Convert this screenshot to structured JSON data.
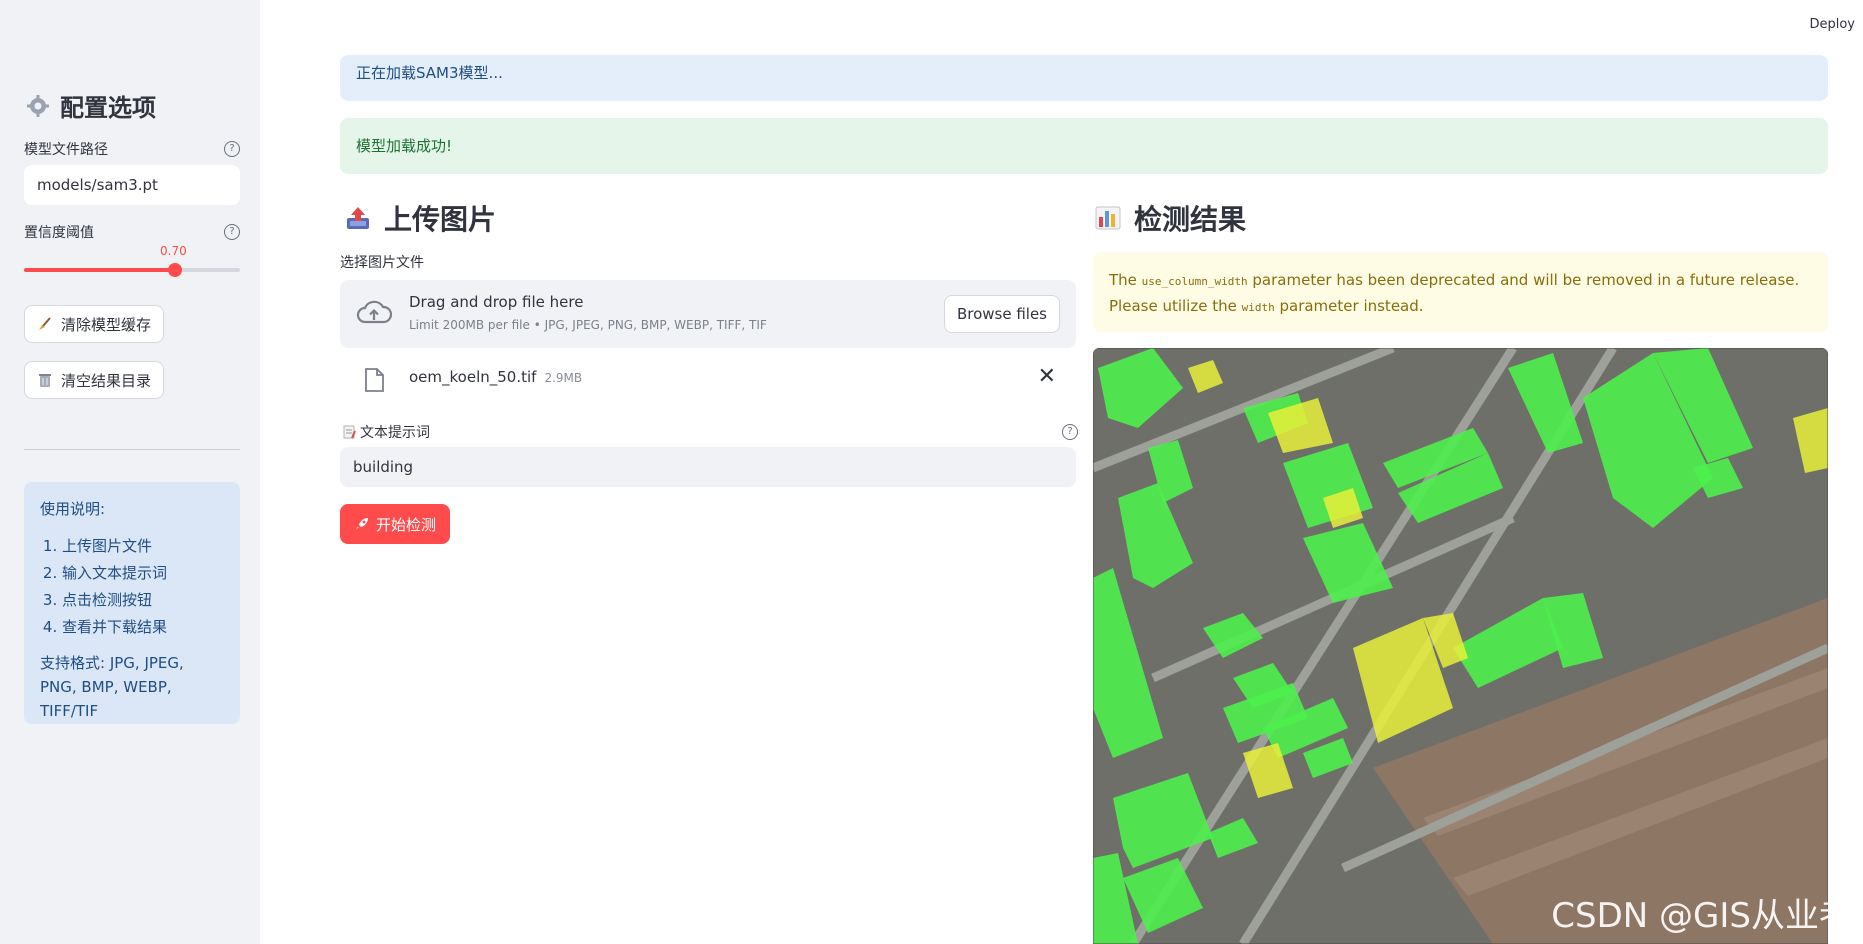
{
  "sidebar": {
    "title": "配置选项",
    "model_path_label": "模型文件路径",
    "model_path_value": "models/sam3.pt",
    "confidence_label": "置信度阈值",
    "confidence_value": "0.70",
    "confidence_fraction": 0.7,
    "clear_cache_button": "清除模型缓存",
    "clear_results_button": "清空结果目录",
    "help_glyph": "?",
    "instructions": {
      "heading": "使用说明:",
      "steps": [
        "上传图片文件",
        "输入文本提示词",
        "点击检测按钮",
        "查看并下载结果"
      ],
      "formats": "支持格式: JPG, JPEG, PNG, BMP, WEBP, TIFF/TIF"
    }
  },
  "header": {
    "deploy": "Deploy"
  },
  "alerts": {
    "loading": "正在加载SAM3模型...",
    "success": "模型加载成功!"
  },
  "upload": {
    "title": "上传图片",
    "file_label": "选择图片文件",
    "drop_text": "Drag and drop file here",
    "limit_text": "Limit 200MB per file • JPG, JPEG, PNG, BMP, WEBP, TIFF, TIF",
    "browse_button": "Browse files",
    "file_name": "oem_koeln_50.tif",
    "file_size": "2.9MB",
    "close_glyph": "✕",
    "prompt_label": "文本提示词",
    "prompt_value": "building",
    "start_button": "开始检测"
  },
  "results": {
    "title": "检测结果",
    "warning_pre": "The ",
    "warning_code1": "use_column_width",
    "warning_mid": " parameter has been deprecated and will be removed in a future release. Please utilize the ",
    "warning_code2": "width",
    "warning_post": " parameter instead."
  },
  "watermark": "CSDN @GIS从业者",
  "colors": {
    "primary": "#ff4b4b",
    "sidebar_bg": "#f0f2f6",
    "info_bg": "#e4eefb",
    "success_bg": "#e6f5ea",
    "warning_bg": "#fffce6",
    "mask_green": "#4cf04c",
    "mask_yellow": "#e8f03a"
  }
}
